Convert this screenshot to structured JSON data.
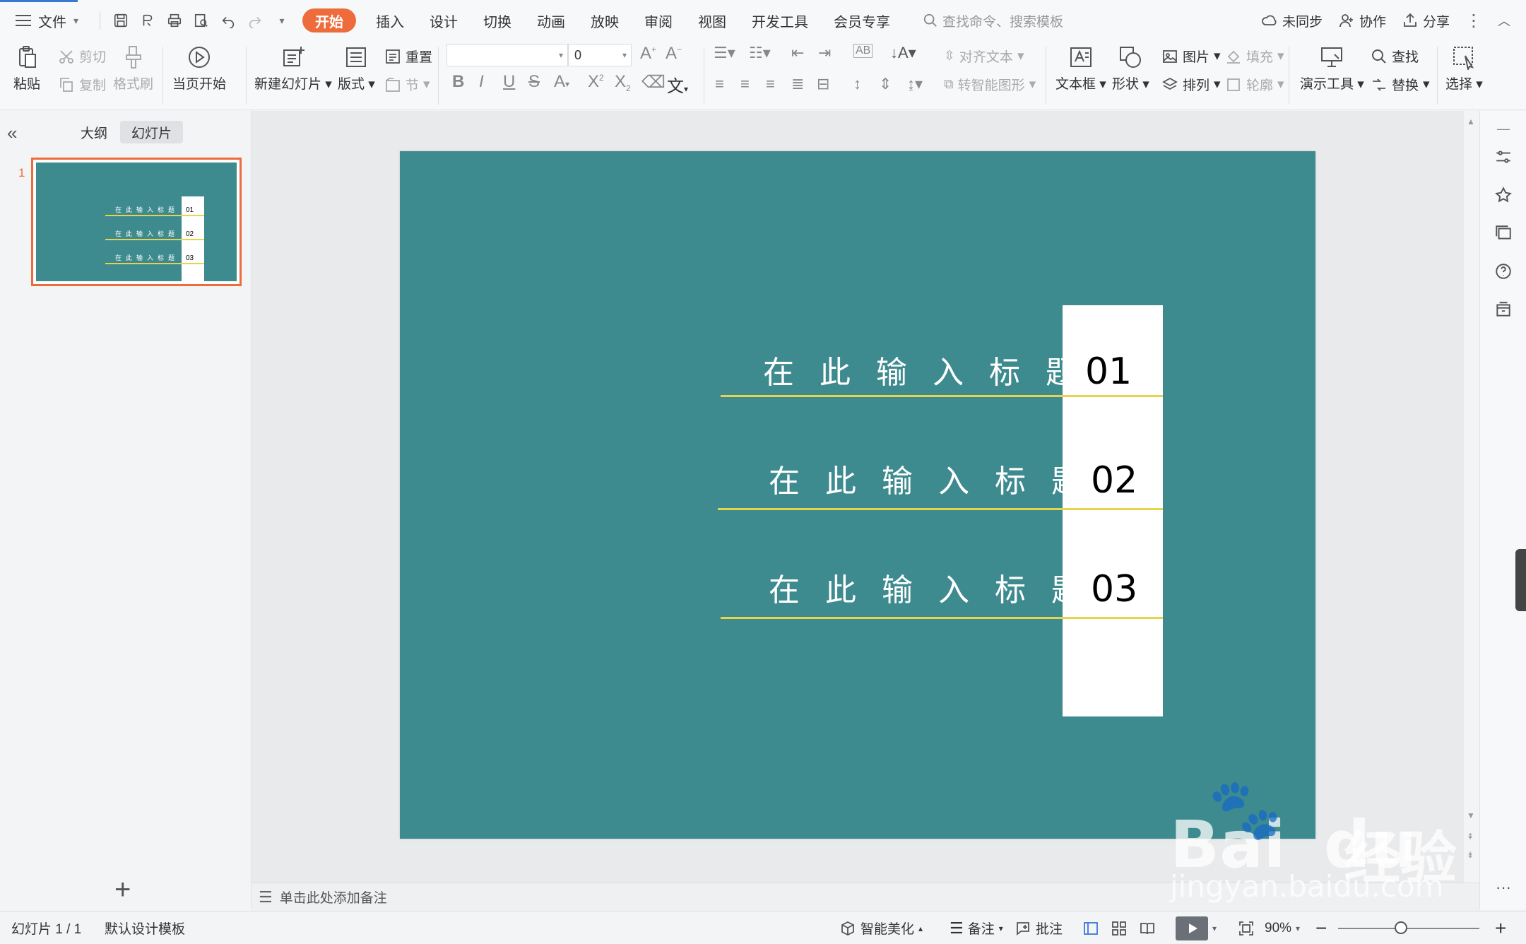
{
  "menubar": {
    "file_label": "文件",
    "tabs": [
      "开始",
      "插入",
      "设计",
      "切换",
      "动画",
      "放映",
      "审阅",
      "视图",
      "开发工具",
      "会员专享"
    ],
    "search_placeholder": "查找命令、搜索模板",
    "sync_label": "未同步",
    "collab_label": "协作",
    "share_label": "分享"
  },
  "ribbon": {
    "paste": "粘贴",
    "cut": "剪切",
    "copy": "复制",
    "format_painter": "格式刷",
    "start_from_current": "当页开始",
    "new_slide": "新建幻灯片",
    "layout": "版式",
    "reset": "重置",
    "section": "节",
    "font_name": "",
    "font_size": "0",
    "align_text": "对齐文本",
    "convert_smartart": "转智能图形",
    "text_box": "文本框",
    "shape": "形状",
    "picture": "图片",
    "arrange": "排列",
    "fill": "填充",
    "outline": "轮廓",
    "presentation_tools": "演示工具",
    "find": "查找",
    "replace": "替换",
    "select": "选择"
  },
  "leftpanel": {
    "tab_outline": "大纲",
    "tab_slides": "幻灯片",
    "slide_number": "1"
  },
  "slide": {
    "background": "#3d8a8f",
    "line_color": "#e6d54a",
    "items": [
      {
        "title": "在此输入标题",
        "number": "01"
      },
      {
        "title": "在此输入标题",
        "number": "02"
      },
      {
        "title": "在此输入标题",
        "number": "03"
      }
    ]
  },
  "notes": {
    "placeholder": "单击此处添加备注"
  },
  "statusbar": {
    "slide_info": "幻灯片 1 / 1",
    "template": "默认设计模板",
    "smart_beautify": "智能美化",
    "notes": "备注",
    "comments": "批注",
    "zoom": "90%"
  },
  "watermark": {
    "brand": "Bai",
    "brand2": "du",
    "product": "经验",
    "url": "jingyan.baidu.com"
  },
  "colors": {
    "accent": "#ee6b3b",
    "slide_bg": "#3d8a8f",
    "yellow_line": "#e6d54a"
  }
}
